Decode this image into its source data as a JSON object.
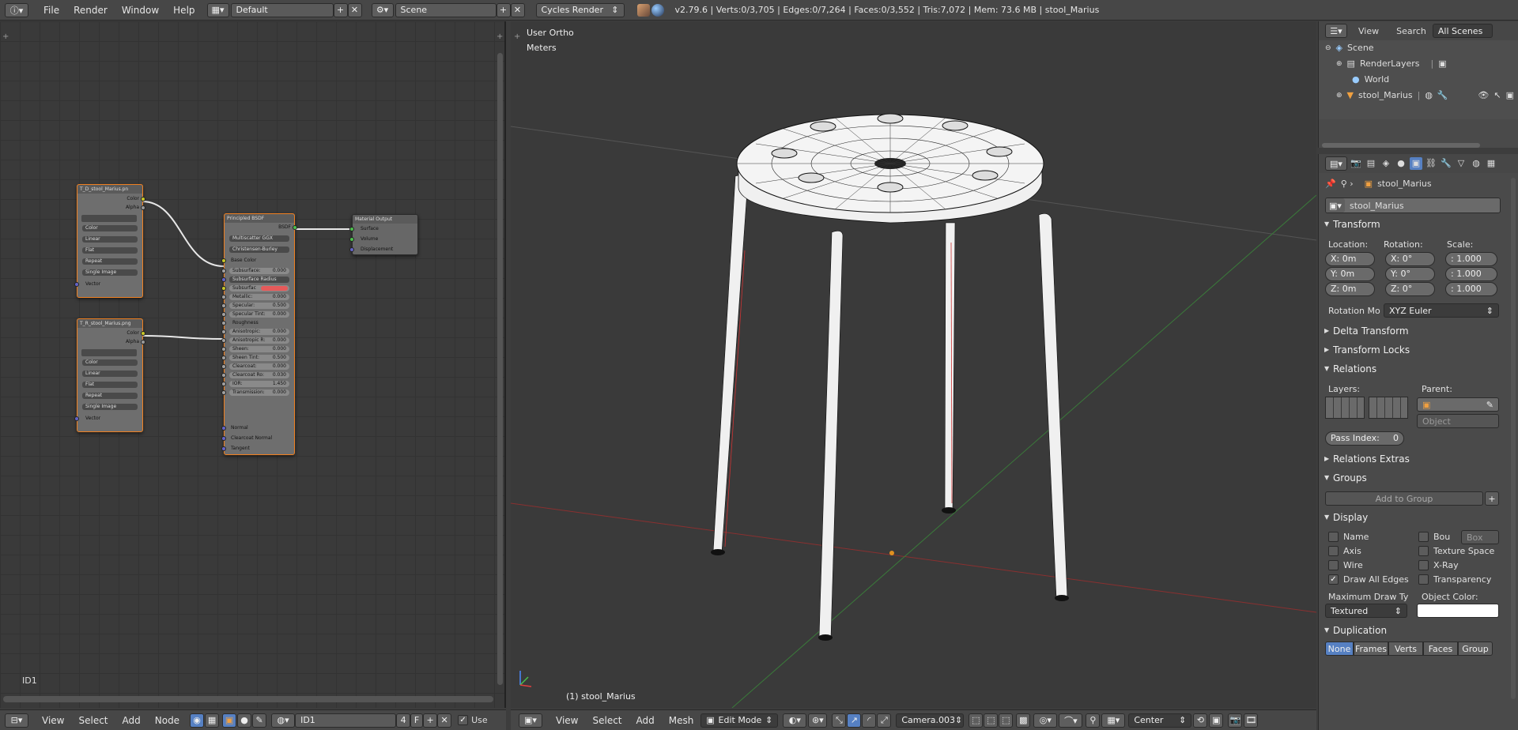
{
  "topbar": {
    "menus": [
      "File",
      "Render",
      "Window",
      "Help"
    ],
    "layout": "Default",
    "scene": "Scene",
    "engine": "Cycles Render",
    "stats": "v2.79.6 | Verts:0/3,705 | Edges:0/7,264 | Faces:0/3,552 | Tris:7,072 | Mem: 73.6 MB | stool_Marius"
  },
  "node_editor": {
    "id_label": "ID1",
    "tex1": {
      "title": "T_D_stool_Marius.pn",
      "out_color": "Color",
      "out_alpha": "Alpha",
      "opts": [
        "Color",
        "Linear",
        "Flat",
        "Repeat",
        "Single Image"
      ],
      "in_vector": "Vector"
    },
    "tex2": {
      "title": "T_R_stool_Marius.png",
      "out_color": "Color",
      "out_alpha": "Alpha",
      "opts": [
        "Color",
        "Linear",
        "Flat",
        "Repeat",
        "Single Image"
      ],
      "in_vector": "Vector"
    },
    "bsdf": {
      "title": "Principled BSDF",
      "out": "BSDF",
      "dd1": "Multiscatter GGX",
      "dd2": "Christensen-Burley",
      "base_color": "Base Color",
      "rows": [
        {
          "label": "Subsurface:",
          "value": "0.000"
        },
        {
          "label": "Subsurface Radius",
          "value": ""
        },
        {
          "label": "Subsurfac",
          "value": ""
        },
        {
          "label": "Metallic:",
          "value": "0.000"
        },
        {
          "label": "Specular:",
          "value": "0.500"
        },
        {
          "label": "Specular Tint:",
          "value": "0.000"
        },
        {
          "label": "Roughness",
          "value": ""
        },
        {
          "label": "Anisotropic:",
          "value": "0.000"
        },
        {
          "label": "Anisotropic R:",
          "value": "0.000"
        },
        {
          "label": "Sheen:",
          "value": "0.000"
        },
        {
          "label": "Sheen Tint:",
          "value": "0.500"
        },
        {
          "label": "Clearcoat:",
          "value": "0.000"
        },
        {
          "label": "Clearcoat Ro:",
          "value": "0.030"
        },
        {
          "label": "IOR:",
          "value": "1.450"
        },
        {
          "label": "Transmission:",
          "value": "0.000"
        }
      ],
      "normal": "Normal",
      "clearcoat_normal": "Clearcoat Normal",
      "tangent": "Tangent"
    },
    "output": {
      "title": "Material Output",
      "surface": "Surface",
      "volume": "Volume",
      "displacement": "Displacement"
    }
  },
  "node_bottom": {
    "menus": [
      "View",
      "Select",
      "Add",
      "Node"
    ],
    "id_name": "ID1",
    "users": "4",
    "fake": "F",
    "use_label": "Use"
  },
  "viewport": {
    "view_label": "User Ortho",
    "units_label": "Meters",
    "object_label": "(1) stool_Marius"
  },
  "view_bottom": {
    "menus": [
      "View",
      "Select",
      "Add",
      "Mesh"
    ],
    "mode": "Edit Mode",
    "camera": "Camera.003",
    "pivot": "Center"
  },
  "outliner": {
    "view": "View",
    "search": "Search",
    "filter": "All Scenes",
    "items": [
      {
        "label": "Scene",
        "indent": 0
      },
      {
        "label": "RenderLayers",
        "indent": 1
      },
      {
        "label": "World",
        "indent": 1
      },
      {
        "label": "stool_Marius",
        "indent": 1
      }
    ]
  },
  "properties": {
    "breadcrumb": "stool_Marius",
    "object_name": "stool_Marius",
    "transform": {
      "title": "Transform",
      "location_label": "Location:",
      "rotation_label": "Rotation:",
      "scale_label": "Scale:",
      "location": [
        "X:  0m",
        "Y:  0m",
        "Z:  0m"
      ],
      "rotation": [
        "X:  0°",
        "Y:  0°",
        "Z:  0°"
      ],
      "scale": [
        ": 1.000",
        ": 1.000",
        ": 1.000"
      ],
      "rotation_mode_label": "Rotation Mo",
      "rotation_mode": "XYZ Euler"
    },
    "delta_transform": "Delta Transform",
    "transform_locks": "Transform Locks",
    "relations": {
      "title": "Relations",
      "layers": "Layers:",
      "parent": "Parent:",
      "parent_type": "Object",
      "pass_index": "Pass Index:",
      "pass_value": "0"
    },
    "relations_extras": "Relations Extras",
    "groups": {
      "title": "Groups",
      "add": "Add to Group"
    },
    "display": {
      "title": "Display",
      "left": [
        "Name",
        "Axis",
        "Wire",
        "Draw All Edges"
      ],
      "right": [
        "Bou",
        "Texture Space",
        "X-Ray",
        "Transparency"
      ],
      "bounds_type": "Box",
      "max_draw_label": "Maximum Draw Ty",
      "max_draw": "Textured",
      "object_color_label": "Object Color:"
    },
    "duplication": {
      "title": "Duplication",
      "tabs": [
        "None",
        "Frames",
        "Verts",
        "Faces",
        "Group"
      ]
    }
  }
}
